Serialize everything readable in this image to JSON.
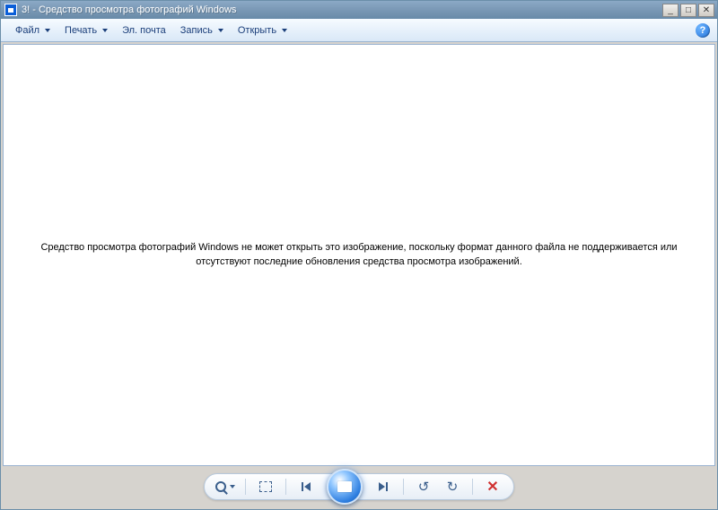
{
  "window": {
    "title": "3! - Средство просмотра фотографий Windows"
  },
  "menu": {
    "file": "Файл",
    "print": "Печать",
    "email": "Эл. почта",
    "burn": "Запись",
    "open": "Открыть"
  },
  "error": {
    "message": "Средство просмотра фотографий Windows не может открыть это изображение, поскольку формат данного файла не поддерживается или отсутствуют последние обновления средства просмотра изображений."
  },
  "controls": {
    "minimize": "_",
    "maximize": "□",
    "close": "✕",
    "help": "?"
  }
}
